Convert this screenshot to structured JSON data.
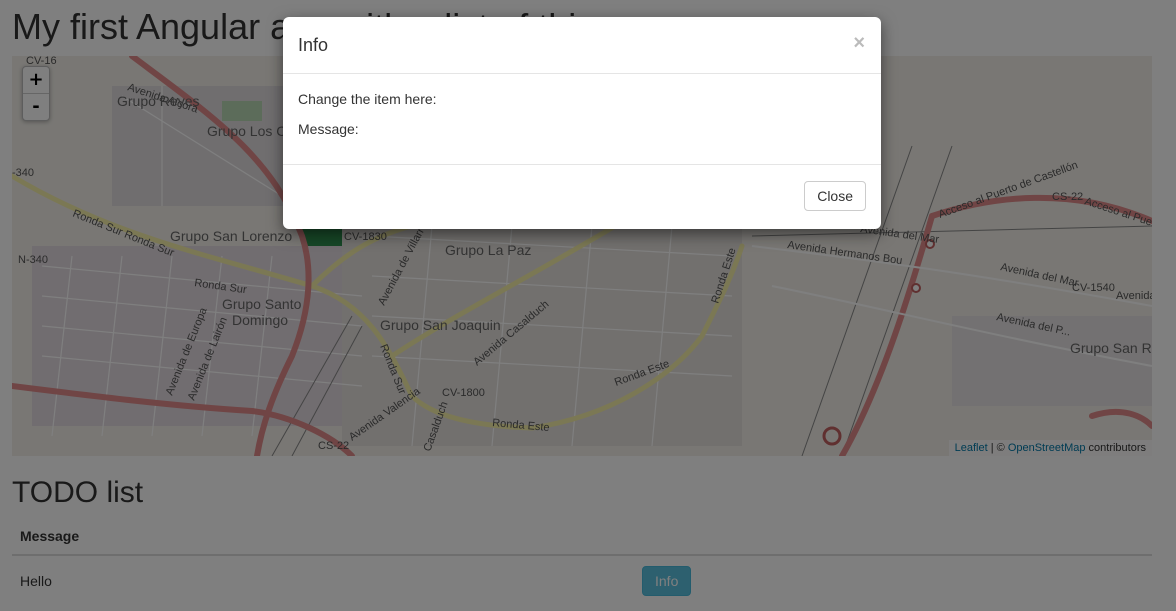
{
  "page": {
    "title": "My first Angular app with a list of things"
  },
  "map": {
    "zoom_in": "+",
    "zoom_out": "-",
    "attribution": {
      "leaflet": "Leaflet",
      "separator": " | © ",
      "osm": "OpenStreetMap",
      "suffix": " contributors"
    },
    "labels": {
      "cv16": "CV-16",
      "avenida_alcora": "Avenida Alcora",
      "grupo_reyes": "Grupo Reyes",
      "grupo_los": "Grupo Los C",
      "n340": "N-340",
      "n340_left": "-340",
      "ronda_sur": "Ronda Sur Ronda Sur",
      "ronda_sur2": "Ronda Sur",
      "grupo_san_lorenzo": "Grupo San Lorenzo",
      "cv1830": "CV-1830",
      "grupo_la_paz": "Grupo La Paz",
      "grupo_santo": "Grupo Santo",
      "domingo": "Domingo",
      "avenida_de_europa": "Avenida de Europa",
      "avenida_de_lauron": "Avenida de Lairón",
      "grupo_san_joaquin": "Grupo San Joaquin",
      "avenida_casalduch": "Avenida Casalduch",
      "cv1800": "CV-1800",
      "ronda_este": "Ronda Este",
      "ronda_este2": "Ronda Este",
      "ronda_este3": "Ronda Este",
      "avenida_valencia": "Avenida Valencia",
      "cs22": "CS-22",
      "cs22_right": "CS-22",
      "acceso_puerto": "Acceso al Puerto de Castellón",
      "acceso_puerto2": "Acceso al Puerto de",
      "avenida_hermanos": "Avenida Hermanos Bou",
      "avenida_del_mar": "Avenida del Mar",
      "avenida_del_mar2": "Avenida del Mar",
      "cv1540": "CV-1540",
      "avenida_d": "Avenida d",
      "avenida_del_p": "Avenida del P...",
      "grupo_san_r": "Grupo San Ro",
      "avenida_villarreal": "Avenida de Villarreal",
      "ronda_sur_v": "Ronda Sur",
      "casalduch2": "Casalduch"
    }
  },
  "todo": {
    "title": "TODO list",
    "columns": [
      "Message"
    ],
    "rows": [
      {
        "message": "Hello",
        "button": "Info"
      }
    ]
  },
  "modal": {
    "title": "Info",
    "close_x": "×",
    "change_label": "Change the item here:",
    "message_label": "Message:",
    "close_button": "Close"
  }
}
